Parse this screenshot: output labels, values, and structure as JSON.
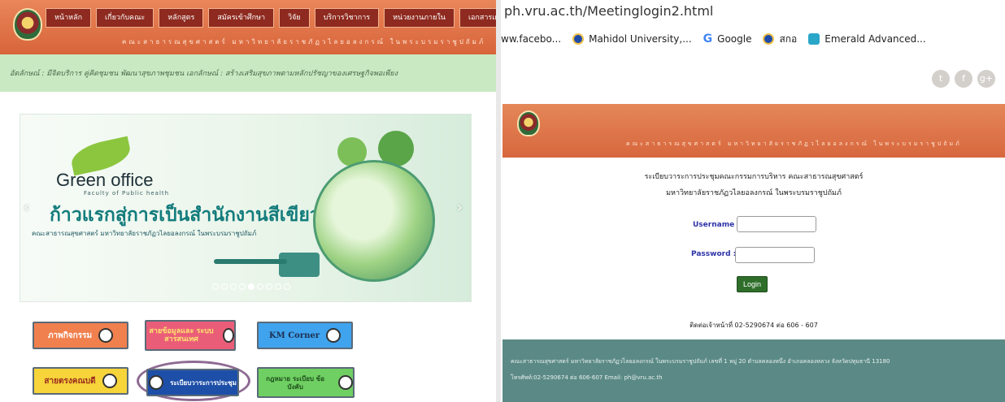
{
  "left": {
    "nav": [
      "หน้าหลัก",
      "เกี่ยวกับคณะ",
      "หลักสูตร",
      "สมัครเข้าศึกษา",
      "วิจัย",
      "บริการวิชาการ",
      "หน่วยงานภายใน",
      "เอกสารเผยแพร่"
    ],
    "subtitle": "คณะสาธารณสุขศาสตร์ มหาวิทยาลัยราชภัฏวไลยอลงกรณ์ ในพระบรมราชูปถัมภ์",
    "banner_text": "อัตลักษณ์ : มีจิตบริการ คู่คิดชุมชน พัฒนาสุขภาพชุมชน เอกลักษณ์ : สร้างเสริมสุขภาพตามหลักปรัชญาของเศรษฐกิจพอเพียง",
    "slide": {
      "brand": "Green office",
      "brand_sub": "Faculty of Public health",
      "headline": "ก้าวแรกสู่การเป็นสำนักงานสีเขียว",
      "caption": "คณะสาธารณสุขศาสตร์ มหาวิทยาลัยราชภัฏวไลยอลงกรณ์ ในพระบรมราชูปถัมภ์",
      "prev": "‹",
      "next": "›",
      "dots_total": 9,
      "active_dot": 5
    },
    "tiles": {
      "activities": "ภาพกิจกรรม",
      "info": "สายข้อมูลและ ระบบสารสนเทศ",
      "km": "KM Corner",
      "survey": "สายตรงคณบดี",
      "meeting": "ระเบียบวาระการประชุม",
      "law": "กฎหมาย ระเบียบ ข้อบังคับ"
    }
  },
  "browser": {
    "url": "ph.vru.ac.th/Meetinglogin2.html",
    "bookmarks": [
      {
        "label": "ww.facebo...",
        "color": "#ffffff"
      },
      {
        "label": "Mahidol University,...",
        "color": "#1f4aa8"
      },
      {
        "label": "Google",
        "color": "#4285f4"
      },
      {
        "label": "สกอ",
        "color": "#1f4aa8"
      },
      {
        "label": "Emerald Advanced...",
        "color": "#2aa6c9"
      }
    ],
    "social": [
      "t",
      "f",
      "g+"
    ]
  },
  "site": {
    "subtitle": "คณะสาธารณสุขศาสตร์ มหาวิทยาลัยราชภัฏวไลยอลงกรณ์ ในพระบรมราชูปถัมภ์",
    "title1": "ระเบียบวาระการประชุมคณะกรรมการบริหาร คณะสาธารณสุขศาสตร์",
    "title2": "มหาวิทยาลัยราชภัฏวไลยอลงกรณ์ ในพระบรมราชูปถัมภ์",
    "username_label": "Username :",
    "password_label": "Password :",
    "login_label": "Login",
    "contact": "ติดต่อเจ้าหน้าที่ 02-5290674 ต่อ 606 - 607",
    "footer1": "คณะสาธารณสุขศาสตร์ มหาวิทยาลัยราชภัฏวไลยอลงกรณ์ ในพระบรมราชูปถัมภ์ เลขที่ 1 หมู่ 20 ตำบลคลองหนึ่ง อำเภอคลองหลวง จังหวัดปทุมธานี 13180",
    "footer2": "โทรศัพท์:02-5290674 ต่อ 606-607 Email: ph@vru.ac.th"
  }
}
